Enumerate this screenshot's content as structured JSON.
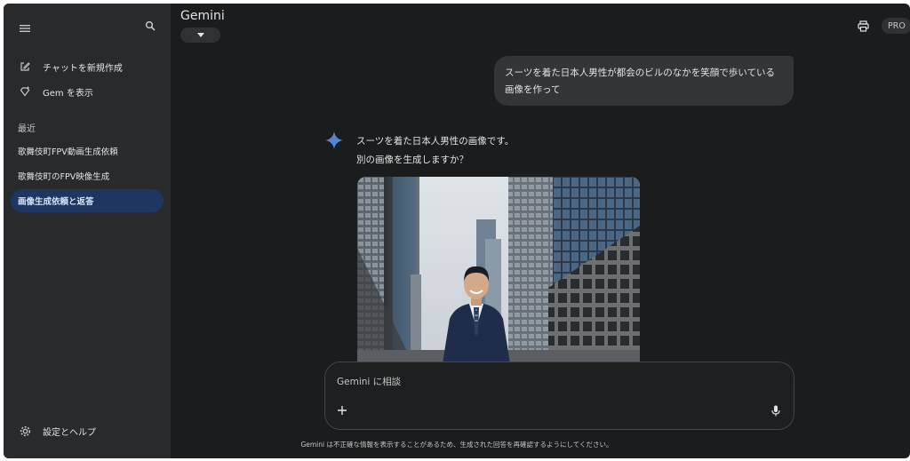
{
  "app": {
    "title": "Gemini",
    "pro_badge": "PRO"
  },
  "sidebar": {
    "new_chat": "チャットを新規作成",
    "gems": "Gem を表示",
    "recent_label": "最近",
    "chats": [
      {
        "label": "歌舞伎町FPV動画生成依頼",
        "active": false
      },
      {
        "label": "歌舞伎町のFPV映像生成",
        "active": false
      },
      {
        "label": "画像生成依頼と返答",
        "active": true
      }
    ],
    "settings": "設定とヘルプ"
  },
  "conversation": {
    "user_message": "スーツを着た日本人男性が都会のビルのなかを笑顔で歩いている画像を作って",
    "reply_line1": "スーツを着た日本人男性の画像です。",
    "reply_line2": "別の画像を生成しますか？"
  },
  "input": {
    "placeholder": "Gemini に相談"
  },
  "footer": {
    "disclaimer": "Gemini は不正確な情報を表示することがあるため、生成された回答を再確認するようにしてください。"
  },
  "colors": {
    "accent_blue": "#4285f4",
    "active_item_bg": "#1f3760",
    "sidebar_bg": "#282a2c",
    "main_bg": "#1b1c1d"
  },
  "icons": [
    "menu-icon",
    "search-icon",
    "edit-icon",
    "gem-icon",
    "caret-down-icon",
    "printer-icon",
    "sparkle-icon",
    "plus-icon",
    "mic-icon",
    "gear-icon"
  ]
}
